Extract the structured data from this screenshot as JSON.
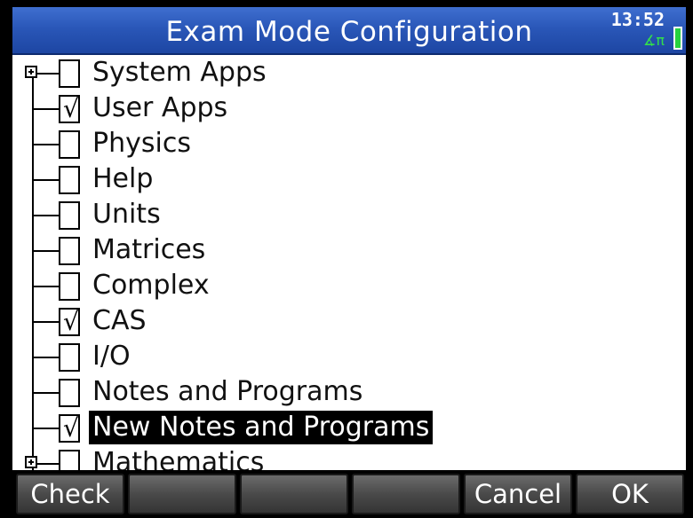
{
  "titlebar": {
    "title": "Exam Mode Configuration",
    "time": "13:52",
    "angle_mode": "∡π",
    "accent": "#2a57b8",
    "battery_color": "#27d23f"
  },
  "tree": {
    "items": [
      {
        "label": "System Apps",
        "checked": false,
        "expandable": true
      },
      {
        "label": "User Apps",
        "checked": true,
        "expandable": false
      },
      {
        "label": "Physics",
        "checked": false,
        "expandable": false
      },
      {
        "label": "Help",
        "checked": false,
        "expandable": false
      },
      {
        "label": "Units",
        "checked": false,
        "expandable": false
      },
      {
        "label": "Matrices",
        "checked": false,
        "expandable": false
      },
      {
        "label": "Complex",
        "checked": false,
        "expandable": false
      },
      {
        "label": "CAS",
        "checked": true,
        "expandable": false
      },
      {
        "label": "I/O",
        "checked": false,
        "expandable": false
      },
      {
        "label": "Notes and Programs",
        "checked": false,
        "expandable": false
      },
      {
        "label": "New Notes and Programs",
        "checked": true,
        "expandable": false,
        "selected": true
      },
      {
        "label": "Mathematics",
        "checked": false,
        "expandable": true
      }
    ],
    "check_glyph": "√"
  },
  "menu": {
    "keys": [
      "Check",
      "",
      "",
      "",
      "Cancel",
      "OK"
    ]
  }
}
